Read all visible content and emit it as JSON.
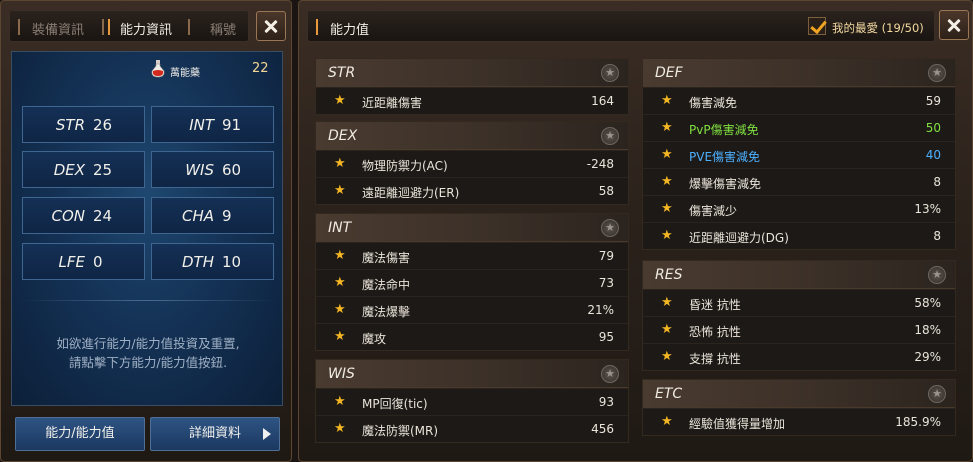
{
  "left": {
    "tabs": [
      {
        "label": "裝備資訊",
        "active": false
      },
      {
        "label": "能力資訊",
        "active": true
      },
      {
        "label": "稱號",
        "active": false
      }
    ],
    "potion": {
      "label": "萬能藥",
      "count": "22"
    },
    "stats": [
      {
        "name": "STR",
        "value": "26"
      },
      {
        "name": "INT",
        "value": "91"
      },
      {
        "name": "DEX",
        "value": "25"
      },
      {
        "name": "WIS",
        "value": "60"
      },
      {
        "name": "CON",
        "value": "24"
      },
      {
        "name": "CHA",
        "value": "9"
      },
      {
        "name": "LFE",
        "value": "0"
      },
      {
        "name": "DTH",
        "value": "10"
      }
    ],
    "hint_line1": "如欲進行能力/能力值投資及重置,",
    "hint_line2": "請點擊下方能力/能力值按鈕.",
    "btn_ability": "能力/能力值",
    "btn_detail": "詳細資料"
  },
  "right": {
    "title": "能力值",
    "favorite": "我的最愛 (19/50)",
    "groups": {
      "str": {
        "title": "STR",
        "rows": [
          {
            "label": "近距離傷害",
            "value": "164"
          }
        ]
      },
      "dex": {
        "title": "DEX",
        "rows": [
          {
            "label": "物理防禦力(AC)",
            "value": "-248"
          },
          {
            "label": "遠距離迴避力(ER)",
            "value": "58"
          }
        ]
      },
      "int": {
        "title": "INT",
        "rows": [
          {
            "label": "魔法傷害",
            "value": "79"
          },
          {
            "label": "魔法命中",
            "value": "73"
          },
          {
            "label": "魔法爆擊",
            "value": "21%"
          },
          {
            "label": "魔攻",
            "value": "95"
          }
        ]
      },
      "wis": {
        "title": "WIS",
        "rows": [
          {
            "label": "MP回復(tic)",
            "value": "93"
          },
          {
            "label": "魔法防禦(MR)",
            "value": "456"
          }
        ]
      },
      "def": {
        "title": "DEF",
        "rows": [
          {
            "label": "傷害減免",
            "value": "59"
          },
          {
            "label": "PvP傷害減免",
            "value": "50"
          },
          {
            "label": "PVE傷害減免",
            "value": "40"
          },
          {
            "label": "爆擊傷害減免",
            "value": "8"
          },
          {
            "label": "傷害減少",
            "value": "13%"
          },
          {
            "label": "近距離迴避力(DG)",
            "value": "8"
          }
        ]
      },
      "res": {
        "title": "RES",
        "rows": [
          {
            "label": "昏迷 抗性",
            "value": "58%"
          },
          {
            "label": "恐怖 抗性",
            "value": "18%"
          },
          {
            "label": "支撐 抗性",
            "value": "29%"
          }
        ]
      },
      "etc": {
        "title": "ETC",
        "rows": [
          {
            "label": "經驗值獲得量增加",
            "value": "185.9%"
          }
        ]
      }
    }
  },
  "colors": {
    "pvp": "#7fe040",
    "pve": "#4cb0ff",
    "star": "#f5b623"
  }
}
